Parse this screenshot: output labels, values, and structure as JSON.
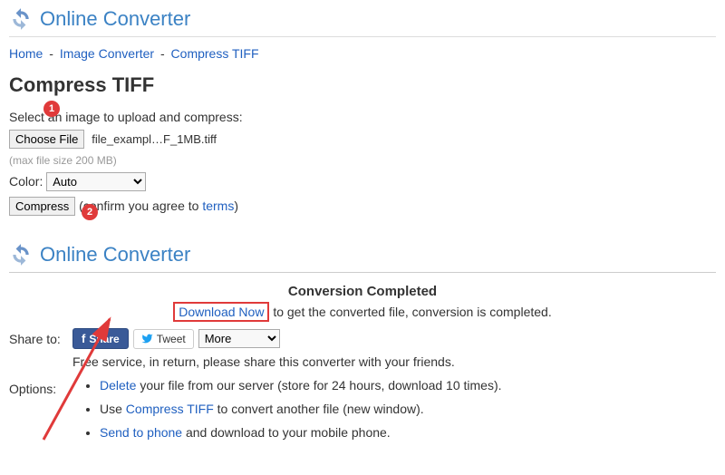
{
  "brand": "Online Converter",
  "breadcrumb": {
    "home": "Home",
    "imageconv": "Image Converter",
    "compress": "Compress TIFF"
  },
  "page_title": "Compress TIFF",
  "select_prompt": "Select an image to upload and compress:",
  "choose_file": "Choose File",
  "filename": "file_exampl…F_1MB.tiff",
  "maxsize": "(max file size 200 MB)",
  "color_label": "Color:",
  "color_value": "Auto",
  "compress_btn": "Compress",
  "confirm_pre": "(confirm you agree to ",
  "terms": "terms",
  "confirm_post": ")",
  "badge1": "1",
  "badge2": "2",
  "completed_title": "Conversion Completed",
  "download_now": "Download Now",
  "download_after": " to get the converted file, conversion is completed.",
  "share_label": "Share to:",
  "fb_share": "Share",
  "tweet": "Tweet",
  "more": "More",
  "share_note": "Free service, in return, please share this converter with your friends.",
  "options_label": "Options:",
  "opt_delete": "Delete",
  "opt_delete_after": " your file from our server (store for 24 hours, download 10 times).",
  "opt_use_pre": "Use ",
  "opt_compress_tiff": "Compress TIFF",
  "opt_use_after": " to convert another file (new window).",
  "opt_send": "Send to phone",
  "opt_send_after": " and download to your mobile phone."
}
